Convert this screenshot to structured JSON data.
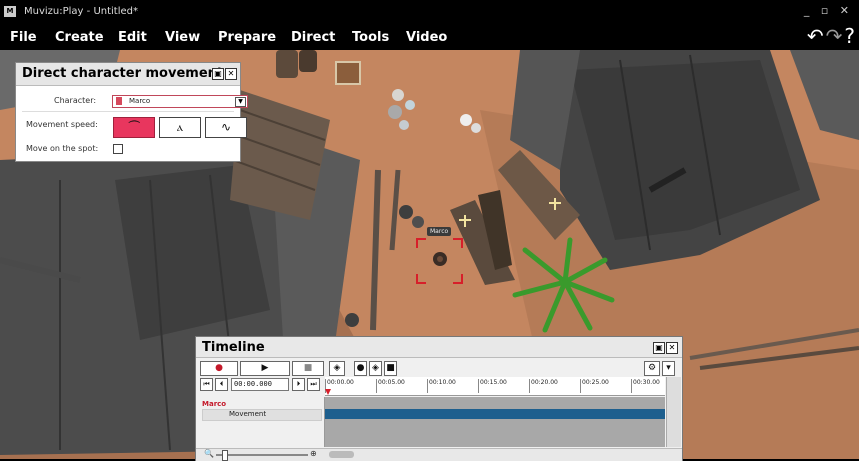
{
  "window": {
    "title": "Muvizu:Play - Untitled*",
    "app_icon": "M",
    "controls": "_ ▫ ✕"
  },
  "menu": {
    "items": [
      "File",
      "Create",
      "Edit",
      "View",
      "Prepare",
      "Direct",
      "Tools",
      "Video"
    ],
    "undo_icon": "undo-icon",
    "redo_icon": "redo-icon",
    "help_label": "?"
  },
  "direct_panel": {
    "title": "Direct character movement",
    "character_label": "Character:",
    "character_value": "Marco",
    "speed_label": "Movement speed:",
    "speed_options": [
      {
        "icon": "run-icon",
        "sub": "",
        "selected": true
      },
      {
        "icon": "walk-icon",
        "sub": "",
        "selected": false
      },
      {
        "icon": "sneak-icon",
        "sub": "",
        "selected": false
      }
    ],
    "spot_label": "Move on the spot:",
    "spot_checked": false
  },
  "scene": {
    "character_tag": "Marco"
  },
  "timeline": {
    "title": "Timeline",
    "timecode": "00:00.000",
    "ticks": [
      "00:00.00",
      "00:05.00",
      "00:10.00",
      "00:15.00",
      "00:20.00",
      "00:25.00",
      "00:30.00"
    ],
    "track_name": "Marco",
    "track_sub": "Movement"
  },
  "colors": {
    "accent_red": "#d71f2a",
    "selected_pink": "#e8365e",
    "track_blue": "#1e5f8e",
    "ground": "#c48660"
  }
}
